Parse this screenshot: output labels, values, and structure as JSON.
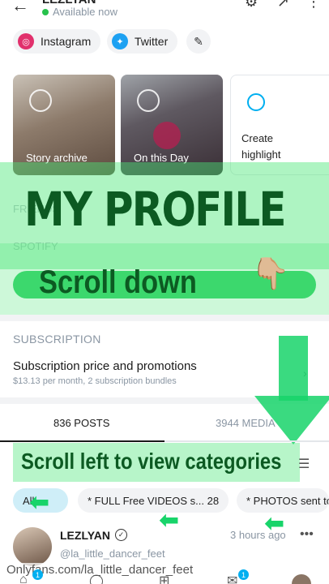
{
  "header": {
    "name": "LEZLYAN",
    "status": "Available now"
  },
  "socials": [
    {
      "label": "Instagram",
      "color": "#e1306c"
    },
    {
      "label": "Twitter",
      "color": "#1da1f2"
    }
  ],
  "highlights": [
    {
      "label": "Story archive"
    },
    {
      "label": "On this Day"
    },
    {
      "label": "Create highlight"
    }
  ],
  "overlay": {
    "title": "MY PROFILE",
    "scroll_down": "Scroll down",
    "hand": "👇🏼",
    "scroll_left": "Scroll left to view categories"
  },
  "faded_sections": {
    "friends": "FRIENDS",
    "spotify": "SPOTIFY"
  },
  "subscription": {
    "section_title": "SUBSCRIPTION",
    "main": "Subscription price and promotions",
    "detail": "$13.13 per month, 2 subscription bundles"
  },
  "tabs": {
    "posts": "836 POSTS",
    "media": "3944 MEDIA"
  },
  "categories": [
    {
      "label": "All"
    },
    {
      "label": "* FULL Free VIDEOS s... 28"
    },
    {
      "label": "* PHOTOS sent to"
    }
  ],
  "post": {
    "name": "LEZLYAN",
    "handle": "@la_little_dancer_feet",
    "time": "3 hours ago"
  },
  "watermark": "Onlyfans.com/la_little_dancer_feet",
  "nav": {
    "badge_home": "1",
    "badge_msg": "1"
  },
  "colors": {
    "accent": "#00aff0",
    "overlay_green": "#18d46a",
    "overlay_text": "#0c5a22"
  }
}
